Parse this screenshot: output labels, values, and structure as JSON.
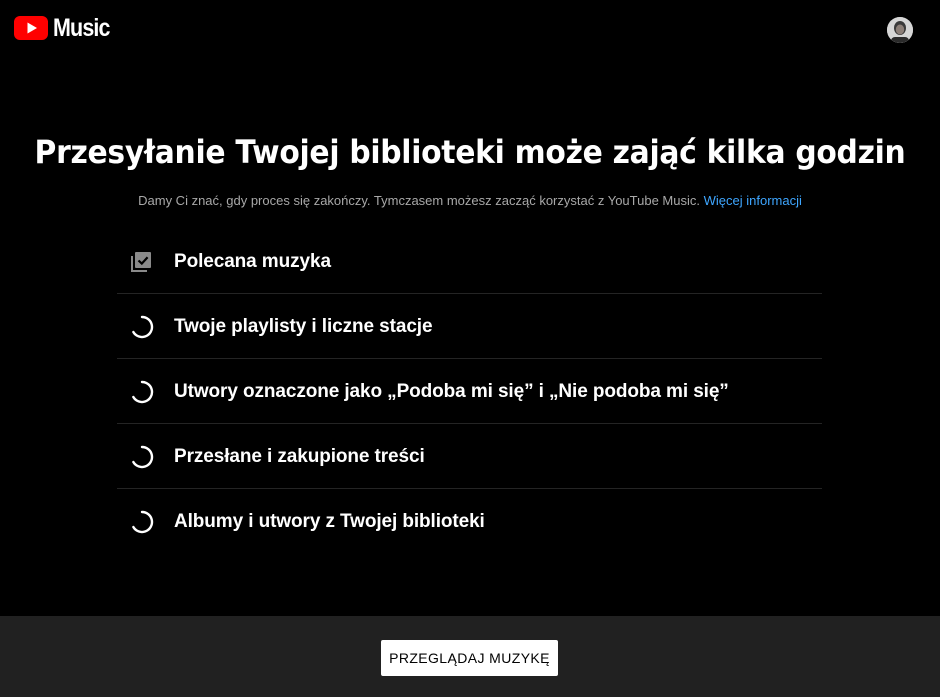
{
  "header": {
    "logo_text": "Music",
    "logo_icon": "youtube-play-icon",
    "avatar_icon": "user-avatar"
  },
  "main": {
    "title": "Przesyłanie Twojej biblioteki może zająć kilka godzin",
    "subtitle": "Damy Ci znać, gdy proces się zakończy. Tymczasem możesz zacząć korzystać z YouTube Music.",
    "more_info_link": "Więcej informacji",
    "steps": [
      {
        "label": "Polecana muzyka",
        "status": "done",
        "icon": "library-check-icon"
      },
      {
        "label": "Twoje playlisty i liczne stacje",
        "status": "loading",
        "icon": "spinner-icon"
      },
      {
        "label": "Utwory oznaczone jako „Podoba mi się” i „Nie podoba mi się”",
        "status": "loading",
        "icon": "spinner-icon"
      },
      {
        "label": "Przesłane i zakupione treści",
        "status": "loading",
        "icon": "spinner-icon"
      },
      {
        "label": "Albumy i utwory z Twojej biblioteki",
        "status": "loading",
        "icon": "spinner-icon"
      }
    ]
  },
  "footer": {
    "browse_button": "PRZEGLĄDAJ MUZYKĘ"
  },
  "colors": {
    "background": "#000000",
    "footer_background": "#212121",
    "link": "#3ea6ff",
    "brand_red": "#ff0000",
    "divider": "#242424"
  }
}
